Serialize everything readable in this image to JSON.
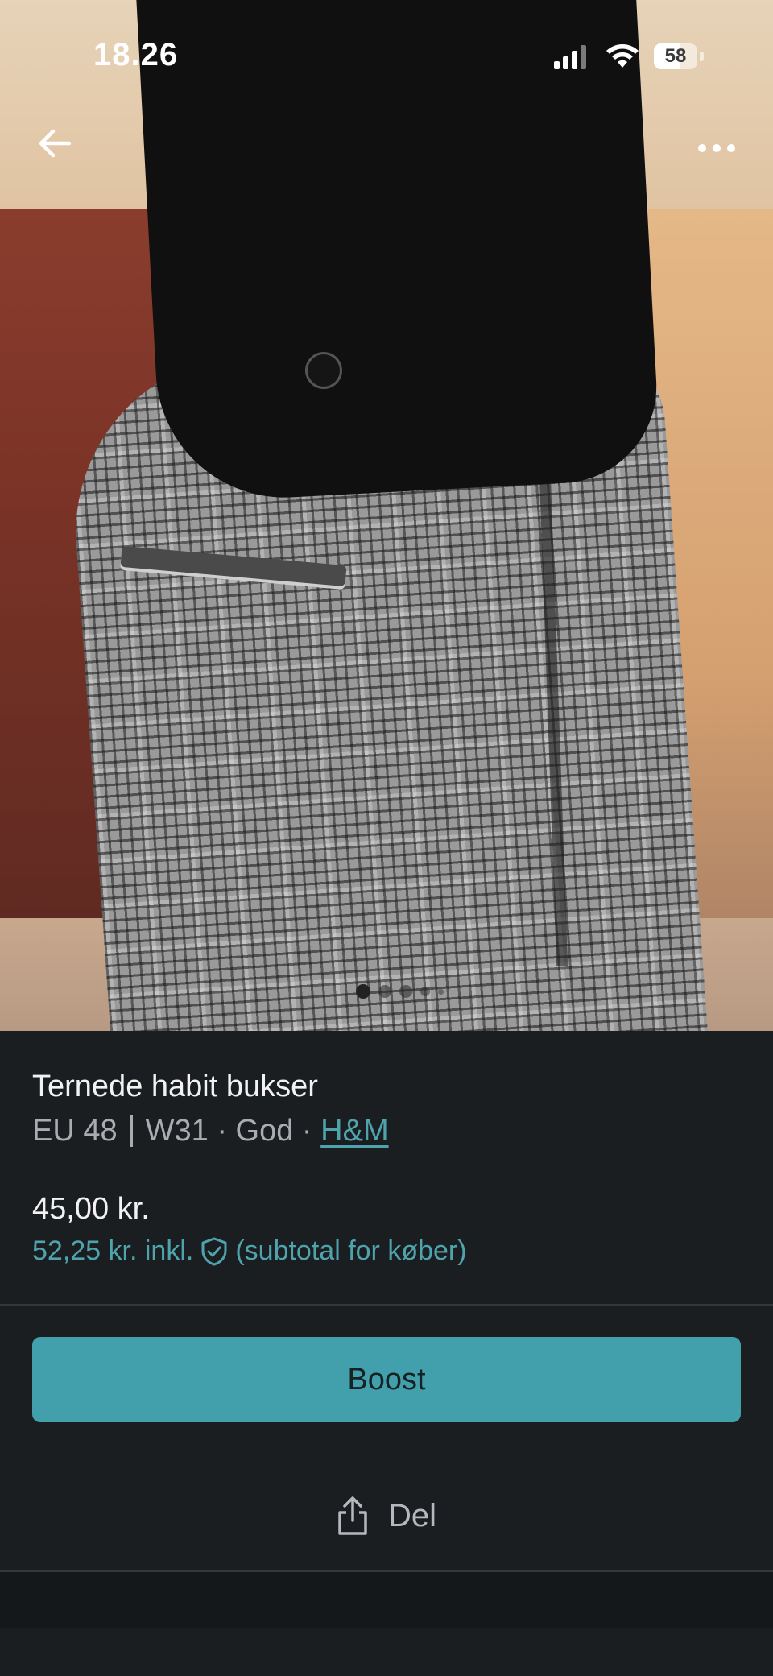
{
  "status_bar": {
    "time": "18.26",
    "battery": "58"
  },
  "nav": {
    "back_icon": "arrow-left-icon",
    "more_icon": "more-horizontal-icon"
  },
  "gallery": {
    "total_images": 5,
    "current_index": 1
  },
  "listing": {
    "title": "Ternede habit bukser",
    "size": "EU 48",
    "waist": "W31",
    "condition": "God",
    "brand": "H&M",
    "price": "45,00 kr.",
    "price_incl": "52,25 kr. inkl.",
    "price_incl_note": "(subtotal for køber)"
  },
  "actions": {
    "boost_label": "Boost",
    "share_label": "Del"
  },
  "colors": {
    "accent": "#42a0ac",
    "link": "#4fa3ad",
    "background": "#1b1e21"
  }
}
